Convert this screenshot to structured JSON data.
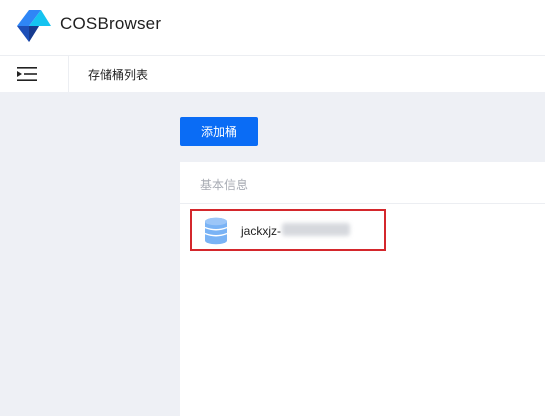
{
  "app": {
    "title": "COSBrowser"
  },
  "nav": {
    "breadcrumb": "存储桶列表",
    "menu_icon": "menu-indent-icon"
  },
  "toolbar": {
    "add_bucket_label": "添加桶"
  },
  "panel": {
    "title": "基本信息",
    "buckets": [
      {
        "name": "jackxjz-",
        "icon": "database-icon",
        "selected": true
      }
    ]
  },
  "colors": {
    "primary": "#0a6cf5",
    "highlight_border": "#d4272c",
    "content_bg": "#eef0f5",
    "muted_text": "#a7abb3"
  }
}
